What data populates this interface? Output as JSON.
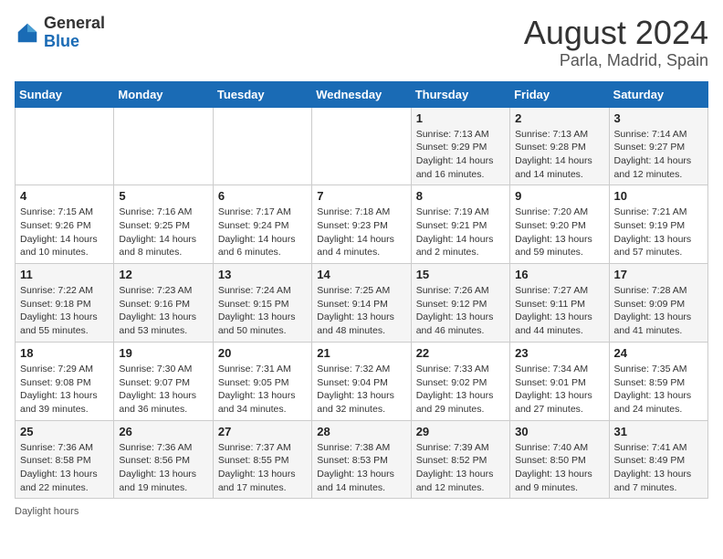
{
  "header": {
    "logo": {
      "general": "General",
      "blue": "Blue"
    },
    "title": "August 2024",
    "location": "Parla, Madrid, Spain"
  },
  "calendar": {
    "days_of_week": [
      "Sunday",
      "Monday",
      "Tuesday",
      "Wednesday",
      "Thursday",
      "Friday",
      "Saturday"
    ],
    "weeks": [
      [
        {
          "day": "",
          "info": ""
        },
        {
          "day": "",
          "info": ""
        },
        {
          "day": "",
          "info": ""
        },
        {
          "day": "",
          "info": ""
        },
        {
          "day": "1",
          "info": "Sunrise: 7:13 AM\nSunset: 9:29 PM\nDaylight: 14 hours and 16 minutes."
        },
        {
          "day": "2",
          "info": "Sunrise: 7:13 AM\nSunset: 9:28 PM\nDaylight: 14 hours and 14 minutes."
        },
        {
          "day": "3",
          "info": "Sunrise: 7:14 AM\nSunset: 9:27 PM\nDaylight: 14 hours and 12 minutes."
        }
      ],
      [
        {
          "day": "4",
          "info": "Sunrise: 7:15 AM\nSunset: 9:26 PM\nDaylight: 14 hours and 10 minutes."
        },
        {
          "day": "5",
          "info": "Sunrise: 7:16 AM\nSunset: 9:25 PM\nDaylight: 14 hours and 8 minutes."
        },
        {
          "day": "6",
          "info": "Sunrise: 7:17 AM\nSunset: 9:24 PM\nDaylight: 14 hours and 6 minutes."
        },
        {
          "day": "7",
          "info": "Sunrise: 7:18 AM\nSunset: 9:23 PM\nDaylight: 14 hours and 4 minutes."
        },
        {
          "day": "8",
          "info": "Sunrise: 7:19 AM\nSunset: 9:21 PM\nDaylight: 14 hours and 2 minutes."
        },
        {
          "day": "9",
          "info": "Sunrise: 7:20 AM\nSunset: 9:20 PM\nDaylight: 13 hours and 59 minutes."
        },
        {
          "day": "10",
          "info": "Sunrise: 7:21 AM\nSunset: 9:19 PM\nDaylight: 13 hours and 57 minutes."
        }
      ],
      [
        {
          "day": "11",
          "info": "Sunrise: 7:22 AM\nSunset: 9:18 PM\nDaylight: 13 hours and 55 minutes."
        },
        {
          "day": "12",
          "info": "Sunrise: 7:23 AM\nSunset: 9:16 PM\nDaylight: 13 hours and 53 minutes."
        },
        {
          "day": "13",
          "info": "Sunrise: 7:24 AM\nSunset: 9:15 PM\nDaylight: 13 hours and 50 minutes."
        },
        {
          "day": "14",
          "info": "Sunrise: 7:25 AM\nSunset: 9:14 PM\nDaylight: 13 hours and 48 minutes."
        },
        {
          "day": "15",
          "info": "Sunrise: 7:26 AM\nSunset: 9:12 PM\nDaylight: 13 hours and 46 minutes."
        },
        {
          "day": "16",
          "info": "Sunrise: 7:27 AM\nSunset: 9:11 PM\nDaylight: 13 hours and 44 minutes."
        },
        {
          "day": "17",
          "info": "Sunrise: 7:28 AM\nSunset: 9:09 PM\nDaylight: 13 hours and 41 minutes."
        }
      ],
      [
        {
          "day": "18",
          "info": "Sunrise: 7:29 AM\nSunset: 9:08 PM\nDaylight: 13 hours and 39 minutes."
        },
        {
          "day": "19",
          "info": "Sunrise: 7:30 AM\nSunset: 9:07 PM\nDaylight: 13 hours and 36 minutes."
        },
        {
          "day": "20",
          "info": "Sunrise: 7:31 AM\nSunset: 9:05 PM\nDaylight: 13 hours and 34 minutes."
        },
        {
          "day": "21",
          "info": "Sunrise: 7:32 AM\nSunset: 9:04 PM\nDaylight: 13 hours and 32 minutes."
        },
        {
          "day": "22",
          "info": "Sunrise: 7:33 AM\nSunset: 9:02 PM\nDaylight: 13 hours and 29 minutes."
        },
        {
          "day": "23",
          "info": "Sunrise: 7:34 AM\nSunset: 9:01 PM\nDaylight: 13 hours and 27 minutes."
        },
        {
          "day": "24",
          "info": "Sunrise: 7:35 AM\nSunset: 8:59 PM\nDaylight: 13 hours and 24 minutes."
        }
      ],
      [
        {
          "day": "25",
          "info": "Sunrise: 7:36 AM\nSunset: 8:58 PM\nDaylight: 13 hours and 22 minutes."
        },
        {
          "day": "26",
          "info": "Sunrise: 7:36 AM\nSunset: 8:56 PM\nDaylight: 13 hours and 19 minutes."
        },
        {
          "day": "27",
          "info": "Sunrise: 7:37 AM\nSunset: 8:55 PM\nDaylight: 13 hours and 17 minutes."
        },
        {
          "day": "28",
          "info": "Sunrise: 7:38 AM\nSunset: 8:53 PM\nDaylight: 13 hours and 14 minutes."
        },
        {
          "day": "29",
          "info": "Sunrise: 7:39 AM\nSunset: 8:52 PM\nDaylight: 13 hours and 12 minutes."
        },
        {
          "day": "30",
          "info": "Sunrise: 7:40 AM\nSunset: 8:50 PM\nDaylight: 13 hours and 9 minutes."
        },
        {
          "day": "31",
          "info": "Sunrise: 7:41 AM\nSunset: 8:49 PM\nDaylight: 13 hours and 7 minutes."
        }
      ]
    ]
  },
  "footer": {
    "note": "Daylight hours"
  }
}
